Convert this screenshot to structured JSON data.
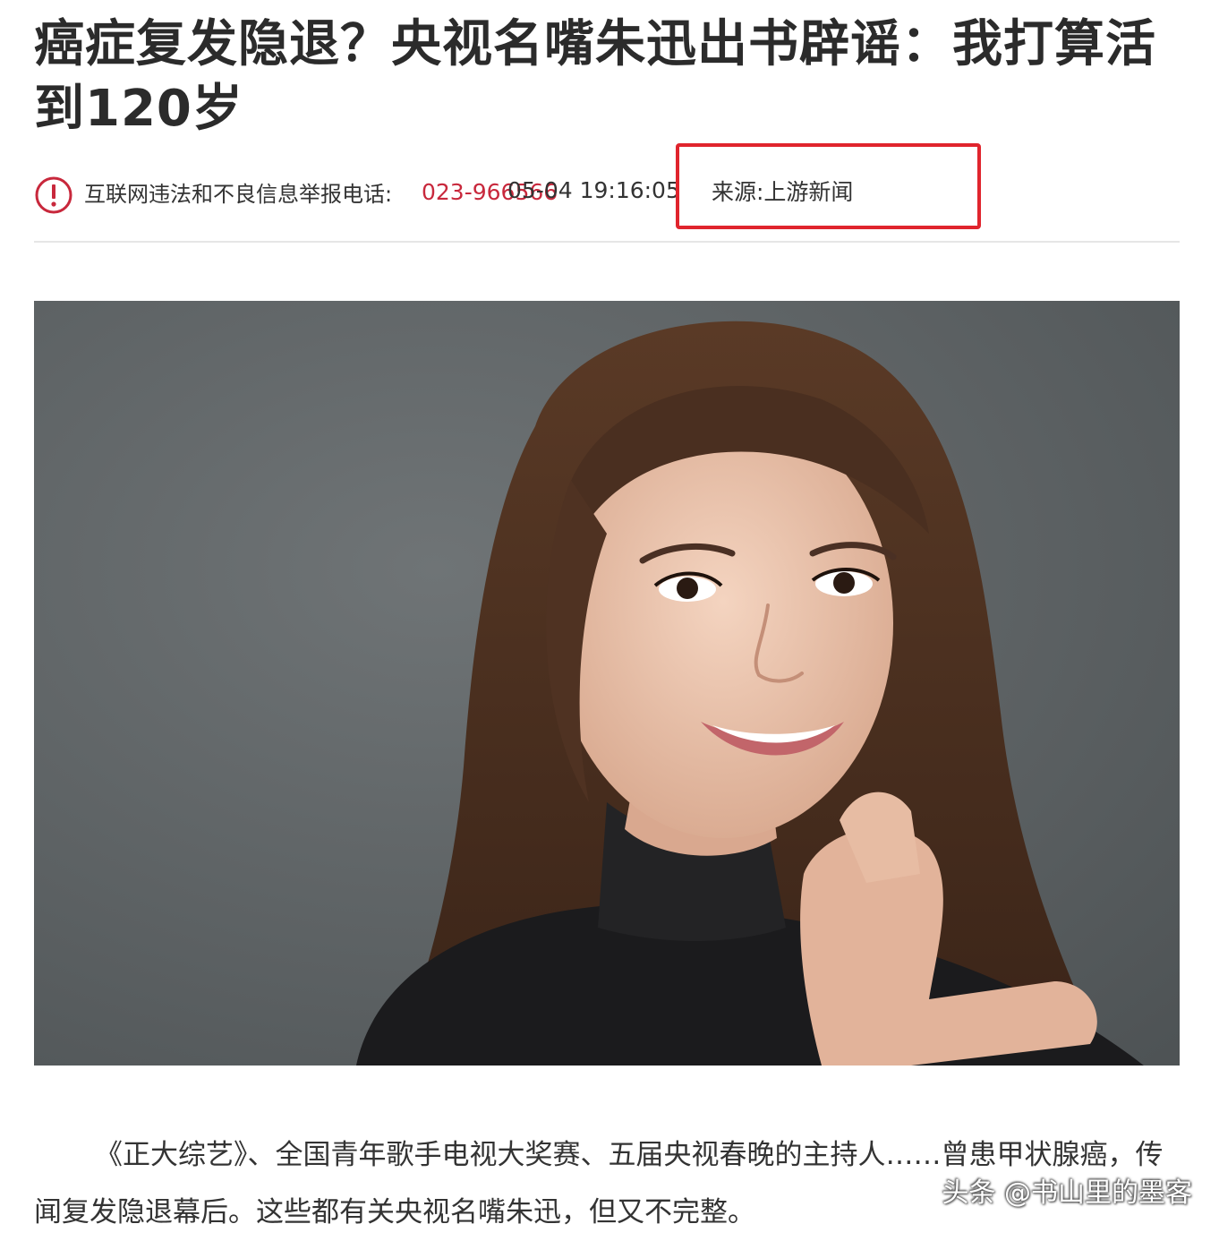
{
  "article": {
    "title": "癌症复发隐退？央视名嘴朱迅出书辟谣：我打算活到120岁",
    "report_label": "互联网违法和不良信息举报电话:",
    "report_phone": "023-966566",
    "timestamp": "05-04 19:16:05",
    "source": "来源:上游新闻",
    "paragraph": "《正大综艺》、全国青年歌手电视大奖赛、五届央视春晚的主持人……曾患甲状腺癌，传闻复发隐退幕后。这些都有关央视名嘴朱迅，但又不完整。",
    "watermark": "头条 @书山里的墨客"
  },
  "icons": {
    "report": "warning-circle-icon"
  },
  "colors": {
    "phone": "#c8283c",
    "highlight_box": "#e0242d",
    "icon": "#c8283c",
    "photo_background": "#5d6264"
  }
}
